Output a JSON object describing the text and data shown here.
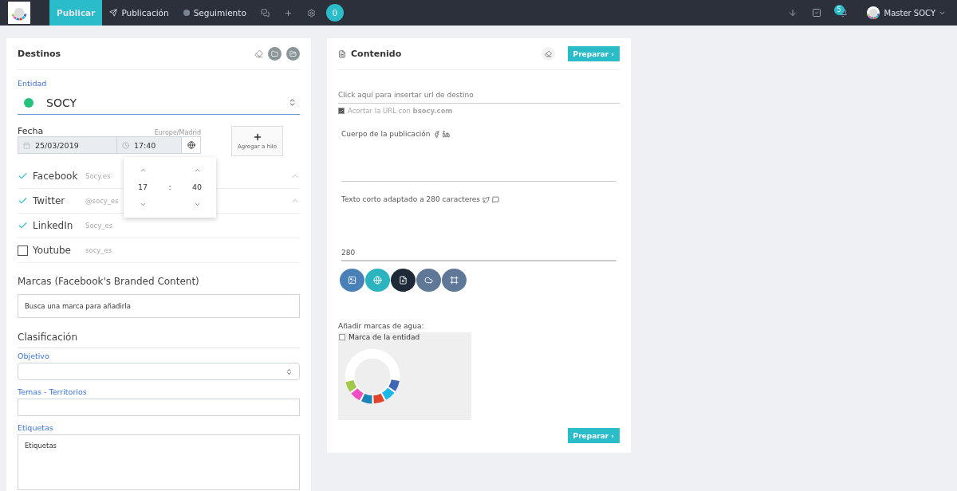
{
  "navbar": {
    "items": [
      {
        "label": "Publicar",
        "selected": true
      },
      {
        "label": "Publicación",
        "selected": false
      },
      {
        "label": "Seguimiento",
        "selected": false
      }
    ],
    "counter": "0",
    "notifications": "5",
    "user": "Master SOCY"
  },
  "destinos": {
    "title": "Destinos",
    "entity_label": "Entidad",
    "entity": "SOCY",
    "date_label": "Fecha",
    "timezone": "Europe/Madrid",
    "date": "25/03/2019",
    "time": "17:40",
    "thread_button": "Agregar a hilo",
    "time_picker": {
      "hours": "17",
      "separator": ":",
      "minutes": "40"
    },
    "networks": [
      {
        "name": "Facebook",
        "account": "Socy.es",
        "checked": true,
        "collapsible": true
      },
      {
        "name": "Twitter",
        "account": "@socy_es",
        "checked": true,
        "collapsible": true
      },
      {
        "name": "LinkedIn",
        "account": "Socy_es",
        "checked": true,
        "collapsible": false
      },
      {
        "name": "Youtube",
        "account": "socy_es",
        "checked": false,
        "collapsible": false
      }
    ],
    "brands_title": "Marcas (Facebook's Branded Content)",
    "brands_placeholder": "Busca una marca para añadirla",
    "classification_title": "Clasificación",
    "objective_label": "Objetivo",
    "topics_label": "Temas - Territorios",
    "tags_label": "Etiquetas",
    "tags_placeholder": "Etiquetas"
  },
  "contenido": {
    "title": "Contenido",
    "prepare_button": "Preparar ›",
    "url_placeholder": "Click aquí para insertar url de destino",
    "shorten_label": "Acortar la URL con **bsocy.com**",
    "shorten_checked": true,
    "body_label": "Cuerpo de la publicación",
    "short_label": "Texto corto adaptado a 280 caracteres",
    "char_count": "280",
    "media_buttons": [
      {
        "kind": "image",
        "color": "#4a80b8"
      },
      {
        "kind": "globe",
        "color": "#2bb3c0"
      },
      {
        "kind": "video",
        "color": "#1f2a38"
      },
      {
        "kind": "cloud",
        "color": "#5f7898"
      },
      {
        "kind": "frame",
        "color": "#5f7898"
      }
    ],
    "watermark_title": "Añadir marcas de agua:",
    "watermark_label": "Marca de la entidad",
    "watermark_checked": false,
    "bottom_button": "Preparar ›"
  }
}
